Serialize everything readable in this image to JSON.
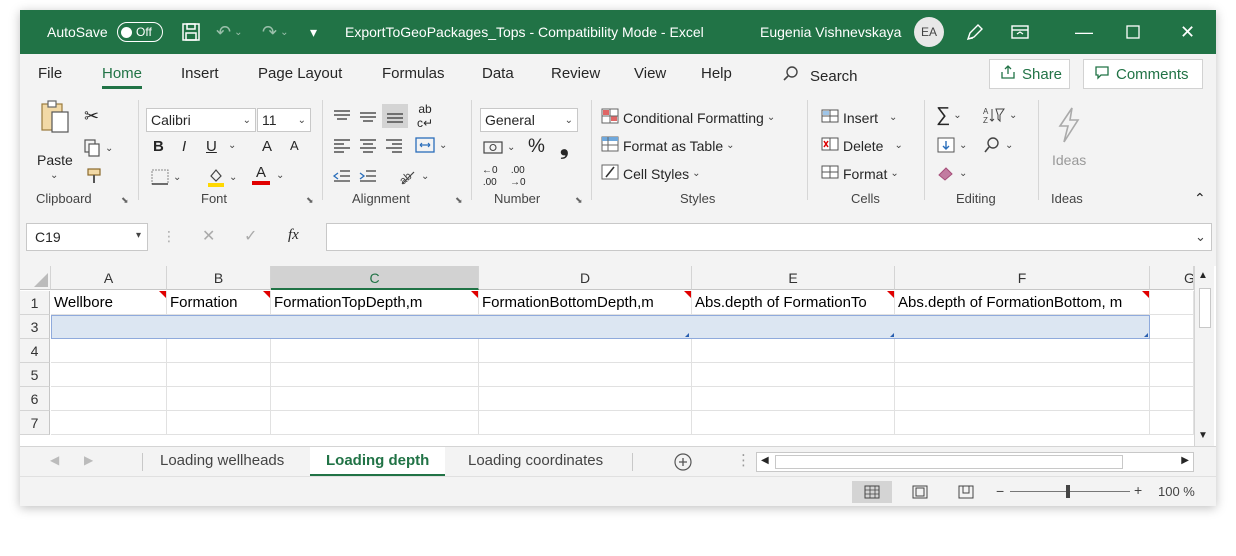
{
  "titlebar": {
    "autosave_label": "AutoSave",
    "autosave_state": "Off",
    "document_title": "ExportToGeoPackages_Tops  -  Compatibility Mode  -  Excel",
    "user_name": "Eugenia Vishnevskaya",
    "user_initials": "EA",
    "accent_color": "#217346"
  },
  "menu": {
    "tabs": [
      "File",
      "Home",
      "Insert",
      "Page Layout",
      "Formulas",
      "Data",
      "Review",
      "View",
      "Help"
    ],
    "active_tab": "Home",
    "search_label": "Search",
    "share_label": "Share",
    "comments_label": "Comments"
  },
  "ribbon": {
    "clipboard": {
      "paste_label": "Paste",
      "group_label": "Clipboard"
    },
    "font": {
      "font_name": "Calibri",
      "font_size": "11",
      "bold": "B",
      "italic": "I",
      "underline": "U",
      "grow": "A",
      "shrink": "A",
      "font_color_letter": "A",
      "group_label": "Font"
    },
    "alignment": {
      "group_label": "Alignment"
    },
    "number": {
      "format": "General",
      "percent": "%",
      "comma": "❟",
      "group_label": "Number"
    },
    "styles": {
      "conditional_formatting": "Conditional Formatting",
      "format_as_table": "Format as Table",
      "cell_styles": "Cell Styles",
      "group_label": "Styles"
    },
    "cells": {
      "insert": "Insert",
      "delete": "Delete",
      "format": "Format",
      "group_label": "Cells"
    },
    "editing": {
      "sum": "∑",
      "group_label": "Editing"
    },
    "ideas": {
      "button_label": "Ideas",
      "group_label": "Ideas"
    }
  },
  "formula_bar": {
    "name_box": "C19",
    "formula": ""
  },
  "grid": {
    "columns": [
      "A",
      "B",
      "C",
      "D",
      "E",
      "F",
      "G"
    ],
    "rows": [
      "1",
      "3",
      "4",
      "5",
      "6",
      "7"
    ],
    "header_row": [
      "Wellbore",
      "Formation",
      "FormationTopDepth,m",
      "FormationBottomDepth,m",
      "Abs.depth of FormationTo",
      "Abs.depth of FormationBottom, m"
    ]
  },
  "sheets": {
    "tabs": [
      "Loading wellheads",
      "Loading depth",
      "Loading coordinates"
    ],
    "active": "Loading depth"
  },
  "status": {
    "zoom": "100 %"
  }
}
